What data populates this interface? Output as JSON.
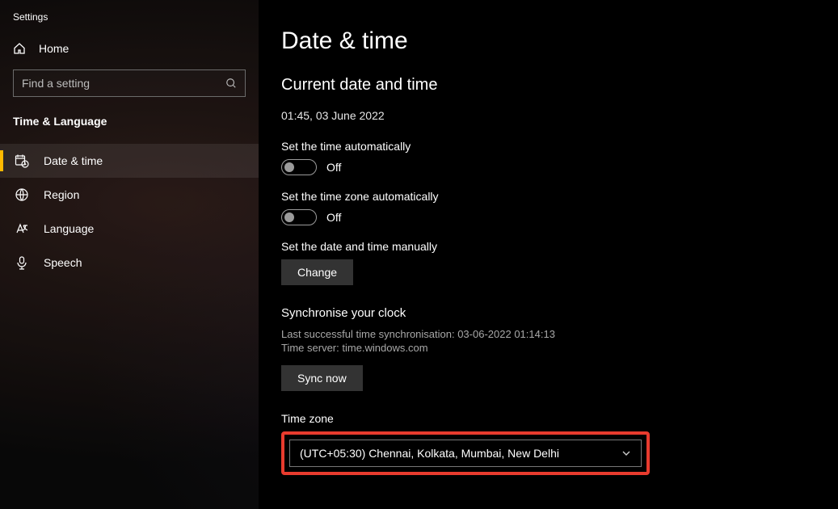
{
  "app_title": "Settings",
  "home_label": "Home",
  "search_placeholder": "Find a setting",
  "category_title": "Time & Language",
  "nav": [
    {
      "label": "Date & time"
    },
    {
      "label": "Region"
    },
    {
      "label": "Language"
    },
    {
      "label": "Speech"
    }
  ],
  "page": {
    "title": "Date & time",
    "section_current": "Current date and time",
    "current_value": "01:45, 03 June 2022",
    "auto_time_label": "Set the time automatically",
    "auto_time_state": "Off",
    "auto_tz_label": "Set the time zone automatically",
    "auto_tz_state": "Off",
    "manual_label": "Set the date and time manually",
    "change_button": "Change",
    "sync": {
      "heading": "Synchronise your clock",
      "last_sync": "Last successful time synchronisation: 03-06-2022 01:14:13",
      "server": "Time server: time.windows.com",
      "button": "Sync now"
    },
    "timezone": {
      "label": "Time zone",
      "selected": "(UTC+05:30) Chennai, Kolkata, Mumbai, New Delhi"
    }
  }
}
